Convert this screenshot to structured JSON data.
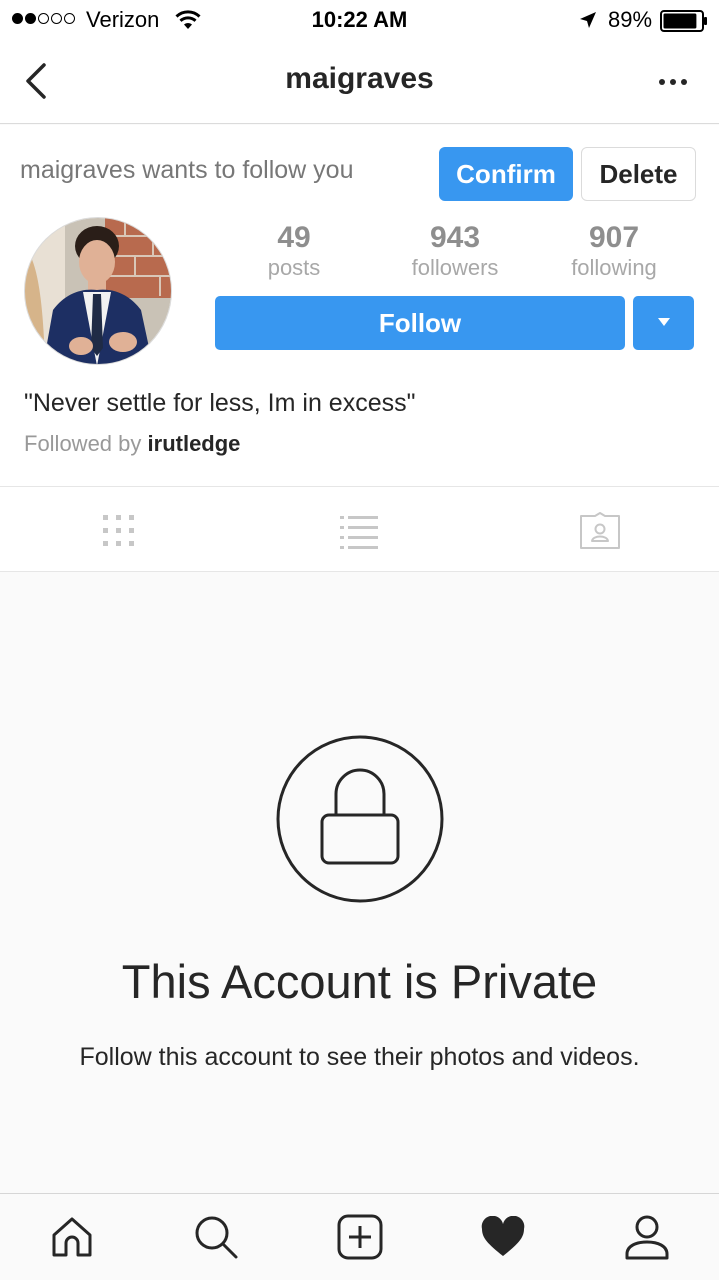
{
  "status_bar": {
    "carrier": "Verizon",
    "time": "10:22 AM",
    "battery": "89%",
    "signal_bars_filled": 2,
    "signal_bars_total": 5,
    "battery_level": 0.89,
    "icons": [
      "wifi-icon",
      "location-arrow-icon",
      "battery-icon"
    ]
  },
  "header": {
    "title": "maigraves",
    "back_icon": "chevron-left-icon",
    "more_icon": "more-horizontal-icon"
  },
  "follow_request": {
    "text": "maigraves wants to follow you",
    "confirm_label": "Confirm",
    "delete_label": "Delete"
  },
  "profile": {
    "stats": {
      "posts": {
        "value": "49",
        "label": "posts"
      },
      "followers": {
        "value": "943",
        "label": "followers"
      },
      "following": {
        "value": "907",
        "label": "following"
      }
    },
    "follow_label": "Follow",
    "bio": "\"Never settle for less, Im in excess\"",
    "followed_by_prefix": "Followed by ",
    "followed_by_user": "irutledge"
  },
  "tabs": [
    "grid-icon",
    "list-icon",
    "tagged-icon"
  ],
  "private": {
    "title": "This Account is Private",
    "description": "Follow this account to see their photos and videos."
  },
  "bottom_bar": [
    "home-icon",
    "search-icon",
    "add-post-icon",
    "activity-heart-icon",
    "profile-icon"
  ],
  "colors": {
    "accent": "#3897f0",
    "text": "#262626",
    "muted": "#8e8e8e",
    "border": "#dbdbdb"
  }
}
